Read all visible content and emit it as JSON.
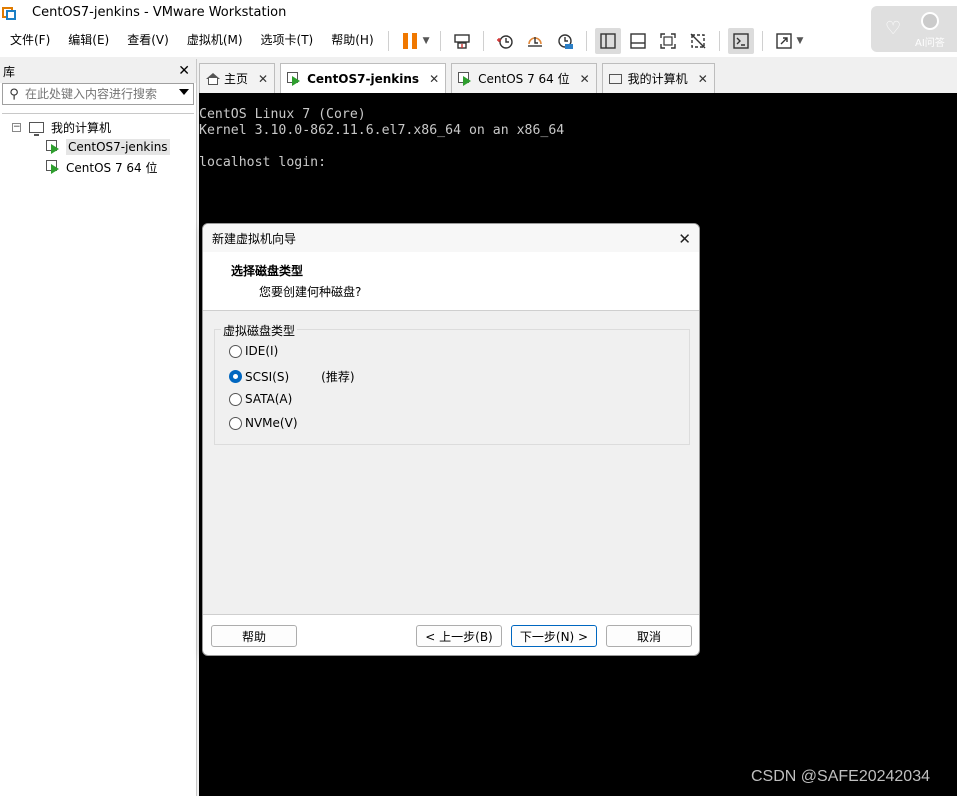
{
  "window": {
    "title": "CentOS7-jenkins - VMware Workstation"
  },
  "menu": [
    "文件(F)",
    "编辑(E)",
    "查看(V)",
    "虚拟机(M)",
    "选项卡(T)",
    "帮助(H)"
  ],
  "ai_widget": {
    "label": "AI问答"
  },
  "library": {
    "title": "库",
    "search_placeholder": "在此处键入内容进行搜索",
    "root": {
      "label": "我的计算机",
      "expander": "−"
    },
    "items": [
      {
        "label": "CentOS7-jenkins"
      },
      {
        "label": "CentOS 7 64 位"
      }
    ]
  },
  "tabs": [
    {
      "label": "主页"
    },
    {
      "label": "CentOS7-jenkins"
    },
    {
      "label": "CentOS 7 64 位"
    },
    {
      "label": "我的计算机"
    }
  ],
  "console": {
    "text": "CentOS Linux 7 (Core)\nKernel 3.10.0-862.11.6.el7.x86_64 on an x86_64\n\nlocalhost login:"
  },
  "dialog": {
    "title": "新建虚拟机向导",
    "heading": "选择磁盘类型",
    "subheading": "您要创建何种磁盘?",
    "group_label": "虚拟磁盘类型",
    "options": [
      {
        "label": "IDE(I)"
      },
      {
        "label": "SCSI(S)",
        "note": "(推荐)"
      },
      {
        "label": "SATA(A)"
      },
      {
        "label": "NVMe(V)"
      }
    ],
    "selected": "SCSI(S)",
    "buttons": {
      "help": "帮助",
      "back": "< 上一步(B)",
      "next": "下一步(N) >",
      "cancel": "取消"
    }
  },
  "watermark": "CSDN @SAFE20242034",
  "colors": {
    "accent": "#0067c0",
    "pause": "#f07800",
    "console_bg": "#000000",
    "vm_play": "#2e9e2e"
  }
}
